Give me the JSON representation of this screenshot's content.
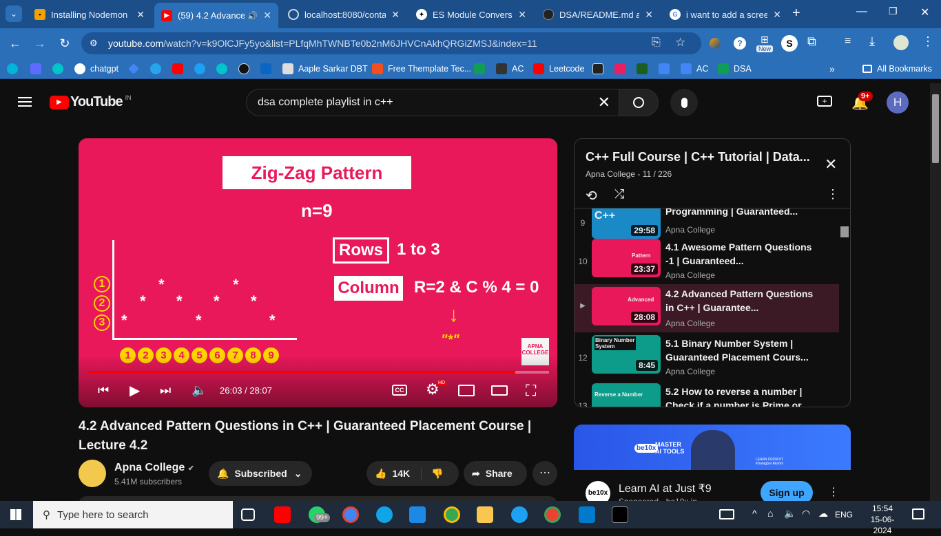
{
  "tabs": [
    {
      "title": "Installing Nodemon",
      "fav_color": "#f4a000",
      "fav_text": "</>"
    },
    {
      "title": "(59) 4.2 Advanced",
      "fav_color": "#ff0000",
      "fav_text": "▶"
    },
    {
      "title": "localhost:8080/conta",
      "fav_color": "#5f6368",
      "fav_text": "⊙"
    },
    {
      "title": "ES Module Conversio",
      "fav_color": "#444",
      "fav_text": "✦"
    },
    {
      "title": "DSA/README.md at",
      "fav_color": "#222",
      "fav_text": "●"
    },
    {
      "title": "i want to add a screen",
      "fav_color": "#fff",
      "fav_text": "G"
    }
  ],
  "address": {
    "host": "youtube.com",
    "path": "/watch?v=k9OlCJFy5yo&list=PLfqMhTWNBTe0b2nM6JHVCnAkhQRGiZMSJ&index=11"
  },
  "bookmarks": [
    {
      "label": "",
      "color": "#00b5d8"
    },
    {
      "label": "",
      "color": "#5b6cff"
    },
    {
      "label": "",
      "color": "#00c4cc"
    },
    {
      "label": "chatgpt",
      "color": "#fff"
    },
    {
      "label": "",
      "color": "#4285f4"
    },
    {
      "label": "",
      "color": "#2aa3ef"
    },
    {
      "label": "",
      "color": "#ff0000"
    },
    {
      "label": "",
      "color": "#1da1f2"
    },
    {
      "label": "",
      "color": "#00c4cc"
    },
    {
      "label": "",
      "color": "#111"
    },
    {
      "label": "",
      "color": "#0a66c2"
    },
    {
      "label": "Aaple Sarkar DBT",
      "color": "#ddd"
    },
    {
      "label": "Free Themplate Tec...",
      "color": "#f24e1e"
    },
    {
      "label": "",
      "color": "#0f9d58"
    },
    {
      "label": "AC",
      "color": "#333"
    },
    {
      "label": "Leetcode",
      "color": "#ff0000"
    },
    {
      "label": "",
      "color": "#222"
    },
    {
      "label": "",
      "color": "#e91e63"
    },
    {
      "label": "",
      "color": "#1b5e20"
    },
    {
      "label": "",
      "color": "#4285f4"
    },
    {
      "label": "AC",
      "color": "#4285f4"
    },
    {
      "label": "DSA",
      "color": "#0f9d58"
    }
  ],
  "bookmarks_all": "All Bookmarks",
  "yt": {
    "logo": "YouTube",
    "country": "IN",
    "search_value": "dsa complete playlist in c++",
    "notif_count": "9+",
    "avatar": "H"
  },
  "video": {
    "slide_title": "Zig-Zag Pattern",
    "n_text": "n=9",
    "rows_label": "Rows",
    "rows_value": "1 to 3",
    "col_label": "Column",
    "col_rule": "R=2 & C % 4 = 0",
    "star_text": "\"*\"",
    "brand": "APNA COLLEGE",
    "row_nums": [
      "1",
      "2",
      "3"
    ],
    "col_nums": [
      "1",
      "2",
      "3",
      "4",
      "5",
      "6",
      "7",
      "8",
      "9"
    ],
    "time": "26:03 / 28:07",
    "progress": 0.927,
    "hd": "HD"
  },
  "title": "4.2 Advanced Pattern Questions in C++ | Guaranteed Placement Course | Lecture 4.2",
  "channel": {
    "name": "Apna College",
    "subs": "5.41M subscribers",
    "subscribed": "Subscribed"
  },
  "likes": "14K",
  "share": "Share",
  "playlist": {
    "title": "C++ Full Course |  C++ Tutorial | Data...",
    "meta": "Apna College - 11 / 226",
    "items": [
      {
        "idx": "9",
        "title": "Programming | Guaranteed...",
        "channel": "Apna College",
        "dur": "29:58",
        "thumb": "#1a8ac7",
        "thumb_text": "C++"
      },
      {
        "idx": "10",
        "title": "4.1 Awesome Pattern Questions -1 | Guaranteed...",
        "channel": "Apna College",
        "dur": "23:37",
        "thumb": "#e8185a",
        "thumb_text": "Pattern"
      },
      {
        "idx": "▶",
        "title": "4.2 Advanced Pattern Questions in C++ | Guarantee...",
        "channel": "Apna College",
        "dur": "28:08",
        "thumb": "#e8185a",
        "thumb_text": "Advanced"
      },
      {
        "idx": "12",
        "title": "5.1 Binary Number System | Guaranteed Placement Cours...",
        "channel": "Apna College",
        "dur": "8:45",
        "thumb": "#0e9c8a",
        "thumb_text": "Binary Number System"
      },
      {
        "idx": "13",
        "title": "5.2 How to reverse a number | Check if a number is Prime or...",
        "channel": "Apna College",
        "dur": "",
        "thumb": "#0e9c8a",
        "thumb_text": "Reverse a Number"
      }
    ]
  },
  "ad": {
    "title": "Learn AI at Just ₹9",
    "sponsor": "Sponsored · be10x.in",
    "cta": "Sign up",
    "banner_text": "MASTER AI TOOLS",
    "banner_brand": "be10x",
    "learn_from": "LEARN FROM IIT Kharagpur Alumni"
  },
  "taskbar": {
    "search": "Type here to search",
    "badge": "99+",
    "lang": "ENG",
    "time": "15:54",
    "date": "15-06-2024"
  }
}
